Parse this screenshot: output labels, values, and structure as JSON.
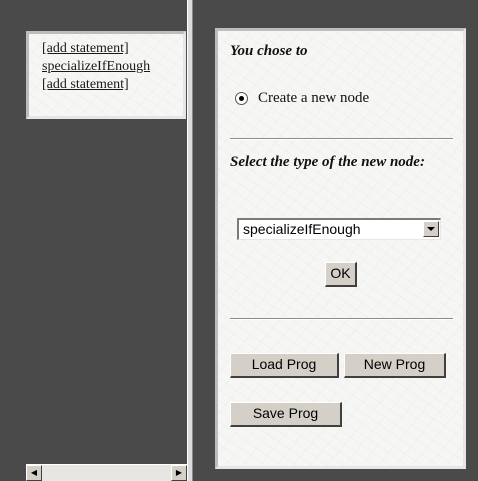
{
  "left_frame": {
    "statements": [
      "[add statement]",
      "specializeIfEnough",
      "[add statement]"
    ]
  },
  "right_panel": {
    "chose_heading": "You chose to",
    "radio_label": "Create a new node",
    "select_type_heading": "Select the type of the new node:",
    "select_value": "specializeIfEnough",
    "ok_label": "OK",
    "load_prog_label": "Load Prog",
    "new_prog_label": "New Prog",
    "save_prog_label": "Save Prog"
  },
  "icons": {
    "scroll_left": "arrow-left-icon",
    "scroll_right": "arrow-right-icon",
    "dropdown": "chevron-down-icon"
  }
}
